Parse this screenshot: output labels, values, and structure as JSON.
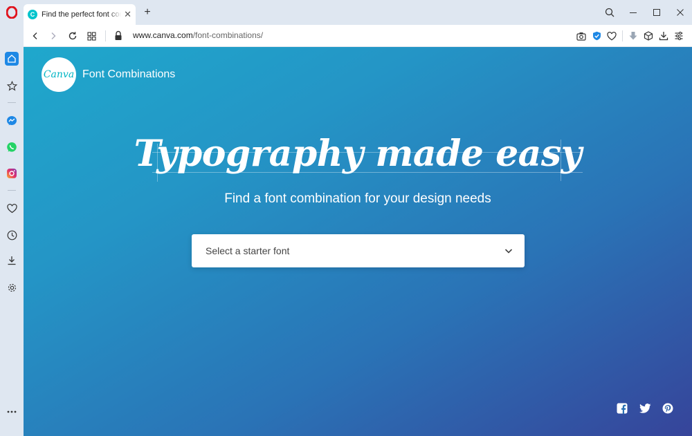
{
  "browser": {
    "tab": {
      "title": "Find the perfect font combinations",
      "favicon_letter": "C"
    },
    "new_tab_label": "+",
    "address": {
      "url_host": "www.canva.com",
      "url_path": "/font-combinations/"
    }
  },
  "page": {
    "brand_name": "Canva",
    "brand_title": "Font Combinations",
    "hero_title": "Typography made easy",
    "hero_subtitle": "Find a font combination for your design needs",
    "select_placeholder": "Select a starter font"
  },
  "colors": {
    "accent": "#1e88e5",
    "canva_teal": "#00c4cc",
    "gradient_start": "#1fa8cc",
    "gradient_end": "#36449a"
  }
}
